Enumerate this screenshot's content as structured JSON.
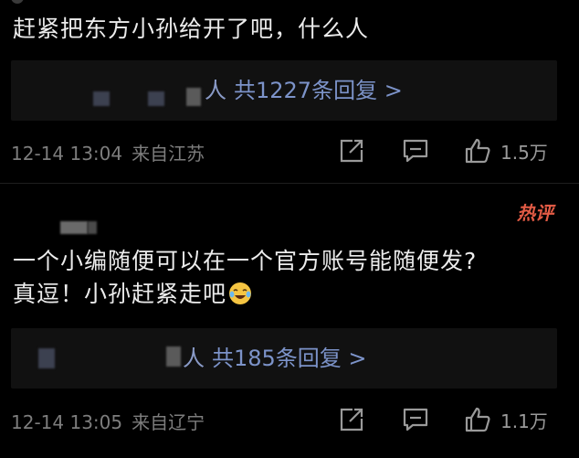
{
  "comments": [
    {
      "text": "赶紧把东方小孙给开了吧，什么人",
      "reply_tail": "人",
      "reply_label": "共1227条回复 >",
      "time": "12-14 13:04",
      "location": "来自江苏",
      "likes": "1.5万"
    },
    {
      "badge": "热评",
      "text_line1": "一个小编随便可以在一个官方账号能随便发?",
      "text_line2": "真逗！小孙赶紧走吧",
      "reply_tail": "人",
      "reply_label": "共185条回复 >",
      "time": "12-14 13:05",
      "location": "来自辽宁",
      "likes": "1.1万"
    }
  ],
  "icons": {
    "share": "share-icon",
    "comment": "comment-icon",
    "like": "thumbs-up-icon",
    "emoji": "laughing-crying-emoji-icon"
  },
  "colors": {
    "background": "#000000",
    "reply_box": "#111111",
    "link": "#7c93c9",
    "meta": "#7d7d7d",
    "hot_badge": "#e25b45"
  }
}
